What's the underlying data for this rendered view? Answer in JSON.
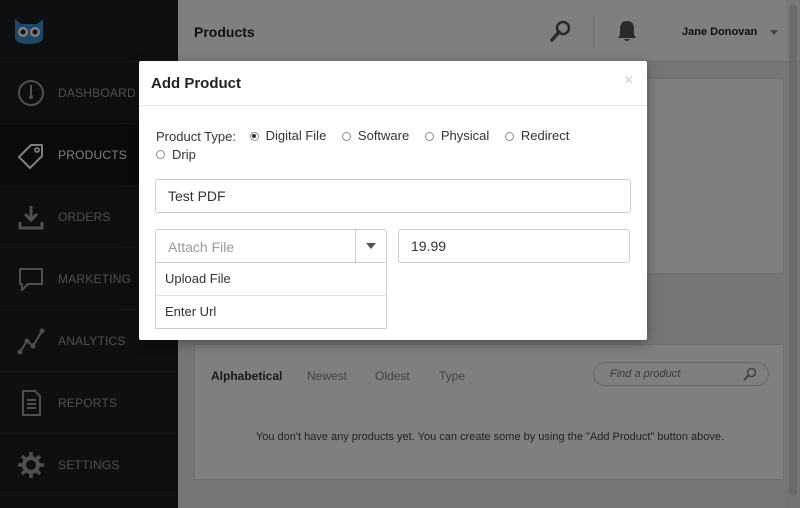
{
  "app": {
    "logo_icon": "owl-logo-icon"
  },
  "sidebar": {
    "items": [
      {
        "label": "DASHBOARD",
        "icon": "dashboard-gauge-icon"
      },
      {
        "label": "PRODUCTS",
        "icon": "tag-icon",
        "active": true
      },
      {
        "label": "ORDERS",
        "icon": "download-tray-icon"
      },
      {
        "label": "MARKETING",
        "icon": "chat-bubble-icon"
      },
      {
        "label": "ANALYTICS",
        "icon": "line-graph-icon"
      },
      {
        "label": "REPORTS",
        "icon": "document-icon"
      },
      {
        "label": "SETTINGS",
        "icon": "gear-icon"
      }
    ]
  },
  "header": {
    "title": "Products",
    "user_name": "Jane Donovan",
    "search_icon": "search-icon",
    "bell_icon": "bell-icon"
  },
  "list": {
    "sort_tabs": [
      "Alphabetical",
      "Newest",
      "Oldest",
      "Type"
    ],
    "search_placeholder": "Find a product",
    "empty_message": "You don't have any products yet. You can create some by using the \"Add Product\" button above."
  },
  "modal": {
    "title": "Add Product",
    "close_label": "×",
    "product_type_label": "Product Type:",
    "product_types": [
      {
        "label": "Digital File",
        "selected": true
      },
      {
        "label": "Software",
        "selected": false
      },
      {
        "label": "Physical",
        "selected": false
      },
      {
        "label": "Redirect",
        "selected": false
      },
      {
        "label": "Drip",
        "selected": false
      }
    ],
    "name_value": "Test PDF",
    "attach_placeholder": "Attach File",
    "attach_options": [
      "Upload File",
      "Enter Url"
    ],
    "price_value": "19.99"
  },
  "colors": {
    "sidebar_bg": "#1d1e20",
    "overlay": "rgba(0,0,0,0.5)",
    "owl_blue": "#3d8fd1"
  }
}
